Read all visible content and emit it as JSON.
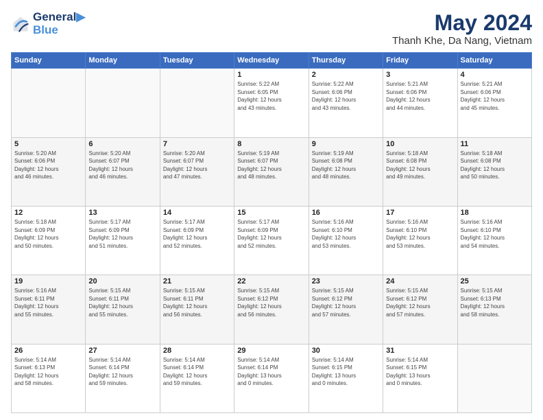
{
  "header": {
    "logo_line1": "General",
    "logo_line2": "Blue",
    "title": "May 2024",
    "subtitle": "Thanh Khe, Da Nang, Vietnam"
  },
  "days_of_week": [
    "Sunday",
    "Monday",
    "Tuesday",
    "Wednesday",
    "Thursday",
    "Friday",
    "Saturday"
  ],
  "weeks": [
    [
      {
        "day": "",
        "info": ""
      },
      {
        "day": "",
        "info": ""
      },
      {
        "day": "",
        "info": ""
      },
      {
        "day": "1",
        "info": "Sunrise: 5:22 AM\nSunset: 6:05 PM\nDaylight: 12 hours\nand 43 minutes."
      },
      {
        "day": "2",
        "info": "Sunrise: 5:22 AM\nSunset: 6:06 PM\nDaylight: 12 hours\nand 43 minutes."
      },
      {
        "day": "3",
        "info": "Sunrise: 5:21 AM\nSunset: 6:06 PM\nDaylight: 12 hours\nand 44 minutes."
      },
      {
        "day": "4",
        "info": "Sunrise: 5:21 AM\nSunset: 6:06 PM\nDaylight: 12 hours\nand 45 minutes."
      }
    ],
    [
      {
        "day": "5",
        "info": "Sunrise: 5:20 AM\nSunset: 6:06 PM\nDaylight: 12 hours\nand 46 minutes."
      },
      {
        "day": "6",
        "info": "Sunrise: 5:20 AM\nSunset: 6:07 PM\nDaylight: 12 hours\nand 46 minutes."
      },
      {
        "day": "7",
        "info": "Sunrise: 5:20 AM\nSunset: 6:07 PM\nDaylight: 12 hours\nand 47 minutes."
      },
      {
        "day": "8",
        "info": "Sunrise: 5:19 AM\nSunset: 6:07 PM\nDaylight: 12 hours\nand 48 minutes."
      },
      {
        "day": "9",
        "info": "Sunrise: 5:19 AM\nSunset: 6:08 PM\nDaylight: 12 hours\nand 48 minutes."
      },
      {
        "day": "10",
        "info": "Sunrise: 5:18 AM\nSunset: 6:08 PM\nDaylight: 12 hours\nand 49 minutes."
      },
      {
        "day": "11",
        "info": "Sunrise: 5:18 AM\nSunset: 6:08 PM\nDaylight: 12 hours\nand 50 minutes."
      }
    ],
    [
      {
        "day": "12",
        "info": "Sunrise: 5:18 AM\nSunset: 6:09 PM\nDaylight: 12 hours\nand 50 minutes."
      },
      {
        "day": "13",
        "info": "Sunrise: 5:17 AM\nSunset: 6:09 PM\nDaylight: 12 hours\nand 51 minutes."
      },
      {
        "day": "14",
        "info": "Sunrise: 5:17 AM\nSunset: 6:09 PM\nDaylight: 12 hours\nand 52 minutes."
      },
      {
        "day": "15",
        "info": "Sunrise: 5:17 AM\nSunset: 6:09 PM\nDaylight: 12 hours\nand 52 minutes."
      },
      {
        "day": "16",
        "info": "Sunrise: 5:16 AM\nSunset: 6:10 PM\nDaylight: 12 hours\nand 53 minutes."
      },
      {
        "day": "17",
        "info": "Sunrise: 5:16 AM\nSunset: 6:10 PM\nDaylight: 12 hours\nand 53 minutes."
      },
      {
        "day": "18",
        "info": "Sunrise: 5:16 AM\nSunset: 6:10 PM\nDaylight: 12 hours\nand 54 minutes."
      }
    ],
    [
      {
        "day": "19",
        "info": "Sunrise: 5:16 AM\nSunset: 6:11 PM\nDaylight: 12 hours\nand 55 minutes."
      },
      {
        "day": "20",
        "info": "Sunrise: 5:15 AM\nSunset: 6:11 PM\nDaylight: 12 hours\nand 55 minutes."
      },
      {
        "day": "21",
        "info": "Sunrise: 5:15 AM\nSunset: 6:11 PM\nDaylight: 12 hours\nand 56 minutes."
      },
      {
        "day": "22",
        "info": "Sunrise: 5:15 AM\nSunset: 6:12 PM\nDaylight: 12 hours\nand 56 minutes."
      },
      {
        "day": "23",
        "info": "Sunrise: 5:15 AM\nSunset: 6:12 PM\nDaylight: 12 hours\nand 57 minutes."
      },
      {
        "day": "24",
        "info": "Sunrise: 5:15 AM\nSunset: 6:12 PM\nDaylight: 12 hours\nand 57 minutes."
      },
      {
        "day": "25",
        "info": "Sunrise: 5:15 AM\nSunset: 6:13 PM\nDaylight: 12 hours\nand 58 minutes."
      }
    ],
    [
      {
        "day": "26",
        "info": "Sunrise: 5:14 AM\nSunset: 6:13 PM\nDaylight: 12 hours\nand 58 minutes."
      },
      {
        "day": "27",
        "info": "Sunrise: 5:14 AM\nSunset: 6:14 PM\nDaylight: 12 hours\nand 59 minutes."
      },
      {
        "day": "28",
        "info": "Sunrise: 5:14 AM\nSunset: 6:14 PM\nDaylight: 12 hours\nand 59 minutes."
      },
      {
        "day": "29",
        "info": "Sunrise: 5:14 AM\nSunset: 6:14 PM\nDaylight: 13 hours\nand 0 minutes."
      },
      {
        "day": "30",
        "info": "Sunrise: 5:14 AM\nSunset: 6:15 PM\nDaylight: 13 hours\nand 0 minutes."
      },
      {
        "day": "31",
        "info": "Sunrise: 5:14 AM\nSunset: 6:15 PM\nDaylight: 13 hours\nand 0 minutes."
      },
      {
        "day": "",
        "info": ""
      }
    ]
  ]
}
